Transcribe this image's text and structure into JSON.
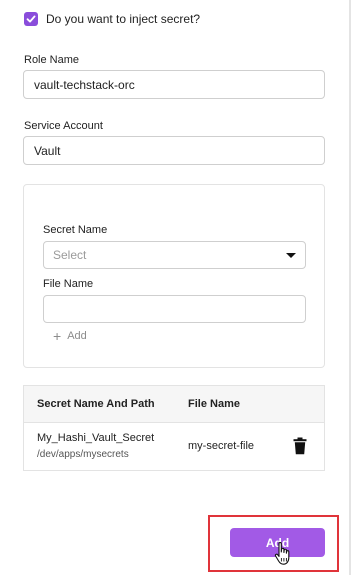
{
  "inject_secret": {
    "label": "Do you want to inject secret?",
    "checked": true
  },
  "role_name": {
    "label": "Role Name",
    "value": "vault-techstack-orc"
  },
  "service_account": {
    "label": "Service Account",
    "value": "Vault"
  },
  "secret_form": {
    "secret_name_label": "Secret Name",
    "secret_name_placeholder": "Select",
    "file_name_label": "File Name",
    "file_name_value": "",
    "add_label": "Add"
  },
  "secrets_table": {
    "columns": [
      "Secret Name And Path",
      "File Name"
    ],
    "rows": [
      {
        "secret_name": "My_Hashi_Vault_Secret",
        "path": "/dev/apps/mysecrets",
        "file_name": "my-secret-file"
      }
    ]
  },
  "footer": {
    "add_button": "Add"
  },
  "colors": {
    "accent": "#a25ae6",
    "checkbox": "#8a4ddb",
    "highlight": "#e0343a"
  },
  "icons": {
    "trash": "trash-icon",
    "checkmark": "checkmark-icon",
    "plus": "plus-icon",
    "cursor": "hand-pointer-cursor"
  }
}
